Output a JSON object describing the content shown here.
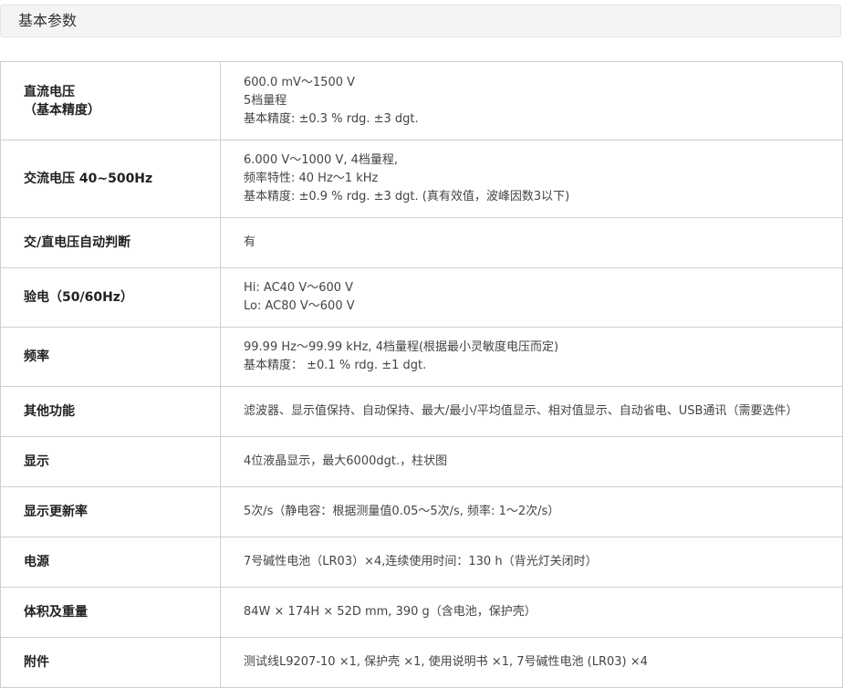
{
  "section": {
    "title": "基本参数"
  },
  "rows": [
    {
      "key": [
        "直流电压",
        "（基本精度）"
      ],
      "value": [
        "600.0 mV～1500 V",
        "5档量程",
        "基本精度: ±0.3 % rdg. ±3 dgt."
      ]
    },
    {
      "key": [
        "交流电压 40~500Hz"
      ],
      "value": [
        "6.000 V～1000 V, 4档量程,",
        "频率特性: 40 Hz～1 kHz",
        "基本精度: ±0.9 % rdg. ±3 dgt. (真有效值，波峰因数3以下)"
      ]
    },
    {
      "key": [
        "交/直电压自动判断"
      ],
      "value": [
        "有"
      ]
    },
    {
      "key": [
        "验电（50/60Hz）"
      ],
      "value": [
        "Hi: AC40 V～600 V",
        "Lo: AC80 V～600 V"
      ]
    },
    {
      "key": [
        "频率"
      ],
      "value": [
        "99.99 Hz～99.99 kHz, 4档量程(根据最小灵敏度电压而定)",
        "基本精度： ±0.1 % rdg. ±1 dgt."
      ]
    },
    {
      "key": [
        "其他功能"
      ],
      "value": [
        "滤波器、显示值保持、自动保持、最大/最小/平均值显示、相对值显示、自动省电、USB通讯（需要选件）"
      ]
    },
    {
      "key": [
        "显示"
      ],
      "value": [
        "4位液晶显示，最大6000dgt.，柱状图"
      ]
    },
    {
      "key": [
        "显示更新率"
      ],
      "value": [
        "5次/s（静电容：根据测量值0.05～5次/s, 频率: 1～2次/s）"
      ]
    },
    {
      "key": [
        "电源"
      ],
      "value": [
        "7号碱性电池（LR03）×4,连续使用时间：130 h（背光灯关闭时）"
      ]
    },
    {
      "key": [
        "体积及重量"
      ],
      "value": [
        "84W × 174H × 52D mm, 390 g（含电池，保护壳）"
      ]
    },
    {
      "key": [
        "附件"
      ],
      "value": [
        "测试线L9207-10 ×1, 保护壳 ×1, 使用说明书 ×1, 7号碱性电池 (LR03) ×4"
      ]
    }
  ]
}
